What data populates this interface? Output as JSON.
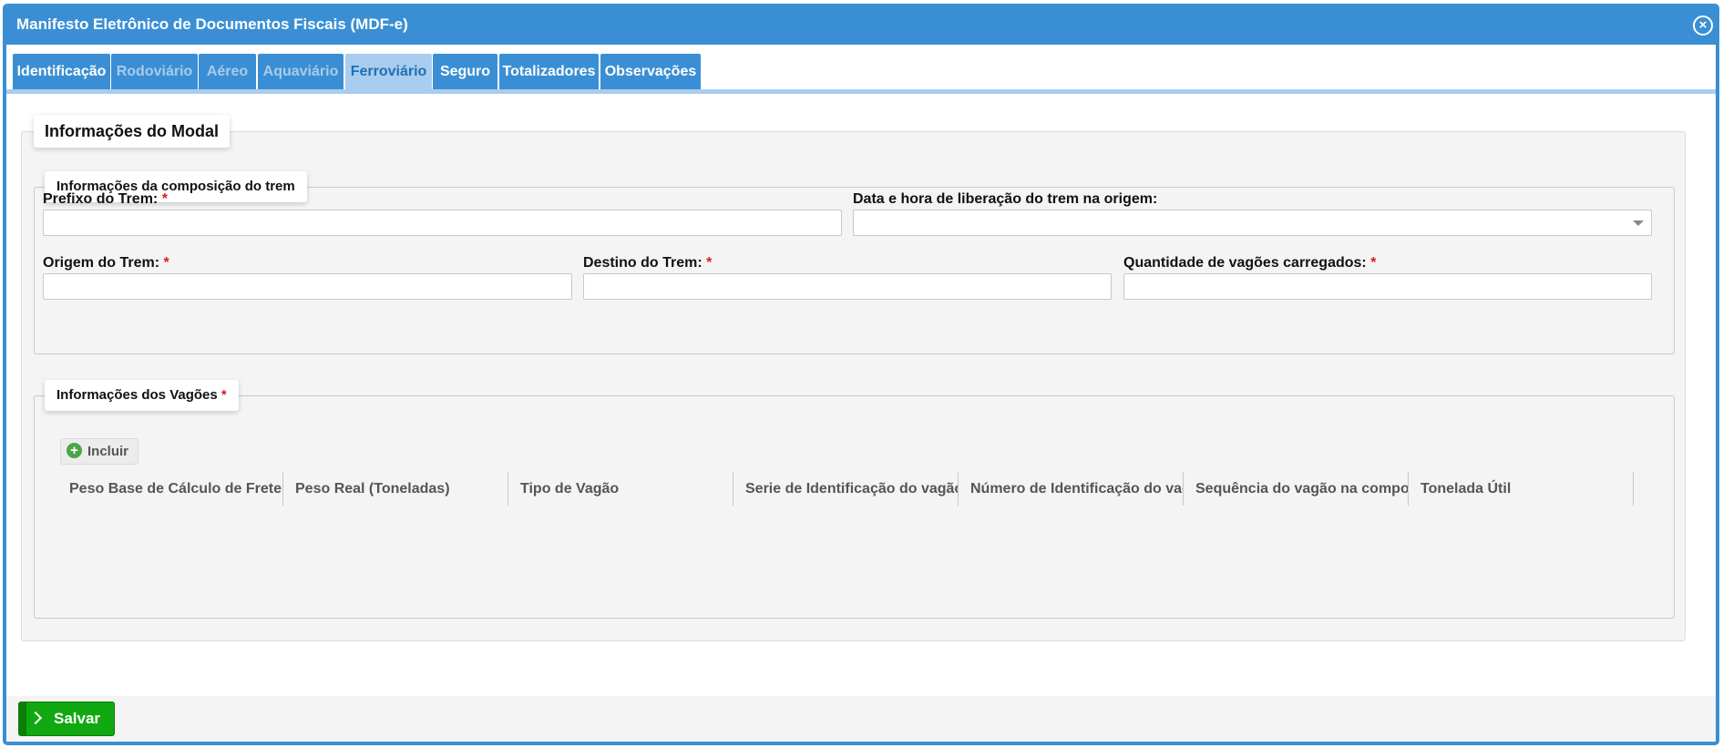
{
  "window": {
    "title": "Manifesto Eletrônico de Documentos Fiscais (MDF-e)",
    "close_glyph": "×"
  },
  "tabs": [
    {
      "label": "Identificação",
      "state": "enabled"
    },
    {
      "label": "Rodoviário",
      "state": "disabled"
    },
    {
      "label": "Aéreo",
      "state": "disabled"
    },
    {
      "label": "Aquaviário",
      "state": "disabled"
    },
    {
      "label": "Ferroviário",
      "state": "active"
    },
    {
      "label": "Seguro",
      "state": "enabled"
    },
    {
      "label": "Totalizadores",
      "state": "enabled"
    },
    {
      "label": "Observações",
      "state": "enabled"
    }
  ],
  "modal_section": {
    "title": "Informações do Modal"
  },
  "train_section": {
    "title": "Informações da composição do trem",
    "fields": {
      "prefix": {
        "label": "Prefixo do Trem:",
        "required": "*",
        "value": ""
      },
      "release": {
        "label": "Data e hora de liberação do trem na origem:",
        "value": ""
      },
      "origin": {
        "label": "Origem do Trem:",
        "required": "*",
        "value": ""
      },
      "destination": {
        "label": "Destino do Trem:",
        "required": "*",
        "value": ""
      },
      "wagon_count": {
        "label": "Quantidade de vagões carregados:",
        "required": "*",
        "value": ""
      }
    }
  },
  "wagons_section": {
    "title": "Informações dos Vagões",
    "required": "*",
    "add_label": "Incluir",
    "add_icon": "plus-circle-icon",
    "columns": [
      "Peso Base de Cálculo de Frete",
      "Peso Real (Toneladas)",
      "Tipo de Vagão",
      "Serie de Identificação do vagão",
      "Número de Identificação do vagão",
      "Sequência do vagão na composição",
      "Tonelada Útil"
    ]
  },
  "footer": {
    "save_label": "Salvar"
  },
  "colors": {
    "primary": "#3a8fd4",
    "active_tab": "#a9cdee",
    "save": "#11a811",
    "required": "#e0191c"
  }
}
